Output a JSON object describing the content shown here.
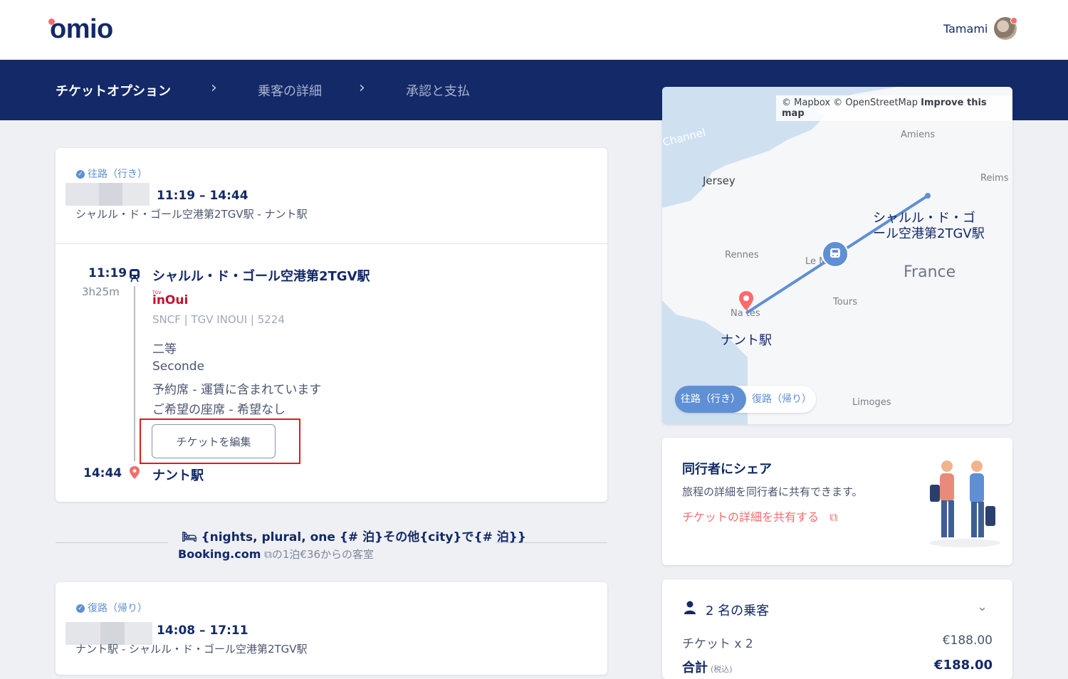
{
  "header": {
    "logo": "omio",
    "user_name": "Tamami"
  },
  "steps": [
    {
      "label": "チケットオプション"
    },
    {
      "label": "乗客の詳細"
    },
    {
      "label": "承認と支払"
    }
  ],
  "outbound": {
    "direction": "往路（行き）",
    "times": "11:19 – 14:44",
    "route": "シャルル・ド・ゴール空港第2TGV駅 - ナント駅",
    "depart_time": "11:19",
    "duration": "3h25m",
    "depart_station": "シャルル・ド・ゴール空港第2TGV駅",
    "operator_logo_top": "TGV",
    "operator_logo": "inOui",
    "operator_info": "SNCF | TGV INOUI | 5224",
    "fare_lines": [
      "二等",
      "Seconde",
      "予約席 - 運賃に含まれています",
      "ご希望の座席 - 希望なし"
    ],
    "edit_button": "チケットを編集",
    "arrive_time": "14:44",
    "arrive_station": "ナント駅"
  },
  "hotel": {
    "headline": "{nights, plural, one {# 泊}その他{city}で{# 泊}}",
    "brand": "Booking.com",
    "offer": "の1泊€36からの客室"
  },
  "return": {
    "direction": "復路（帰り）",
    "times": "14:08 – 17:11",
    "route": "ナント駅 - シャルル・ド・ゴール空港第2TGV駅"
  },
  "map": {
    "attribution_a": "© Mapbox © OpenStreetMap",
    "attribution_b": "Improve this map",
    "labels": {
      "channel": "Channel",
      "amiens": "Amiens",
      "jersey": "Jersey",
      "reims": "Reims",
      "rennes": "Rennes",
      "lemans": "Le M",
      "france": "France",
      "tours": "Tours",
      "nantes": "Na  tes",
      "limoges": "Limoges",
      "cdg_line1": "シャルル・ド・ゴ",
      "cdg_line2": "ール空港第2TGV駅",
      "nantes_station": "ナント駅"
    },
    "toggle_out": "往路（行き）",
    "toggle_ret": "復路（帰り）"
  },
  "share": {
    "title": "同行者にシェア",
    "desc": "旅程の詳細を同行者に共有できます。",
    "link": "チケットの詳細を共有する"
  },
  "price": {
    "passengers": "2 名の乗客",
    "ticket_label": "チケット x 2",
    "ticket_price": "€188.00",
    "total_label": "合計",
    "total_note": "(税込)",
    "total_price": "€188.00"
  },
  "colors": {
    "navy": "#132968",
    "accent_blue": "#5f8fd4",
    "coral": "#fa6b6b"
  }
}
